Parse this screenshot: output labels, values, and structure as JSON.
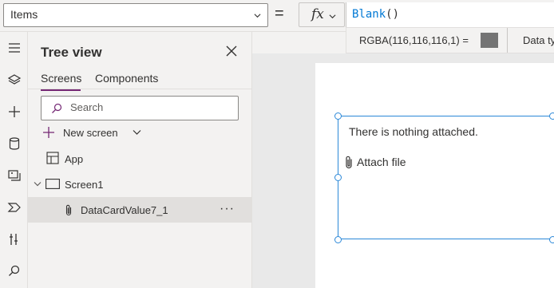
{
  "formula_bar": {
    "property": "Items",
    "fx_label": "fx",
    "formula_function": "Blank",
    "formula_parens": "()"
  },
  "hint": {
    "color_value": "RGBA(116,116,116,1)  =",
    "swatch_color": "#747474",
    "data_type_label": "Data ty"
  },
  "rail": {
    "icons": [
      "menu-icon",
      "layers-icon",
      "insert-icon",
      "data-icon",
      "media-icon",
      "power-automate-icon",
      "advanced-tools-icon",
      "search-icon"
    ]
  },
  "tree_view": {
    "title": "Tree view",
    "tabs": [
      "Screens",
      "Components"
    ],
    "active_tab": "Screens",
    "search_placeholder": "Search",
    "new_screen_label": "New screen",
    "items": [
      {
        "label": "App",
        "icon": "app-icon"
      },
      {
        "label": "Screen1",
        "icon": "screen-icon",
        "expanded": true
      },
      {
        "label": "DataCardValue7_1",
        "icon": "attachment-icon",
        "selected": true
      }
    ],
    "more_label": "···"
  },
  "canvas": {
    "empty_message": "There is nothing attached.",
    "attach_label": "Attach file"
  },
  "colors": {
    "accent": "#742774",
    "selection": "#2b88d8",
    "formula_text": "#0078d4"
  }
}
